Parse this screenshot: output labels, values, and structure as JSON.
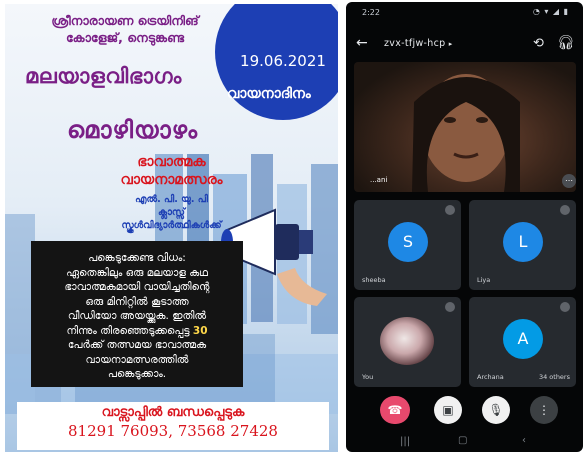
{
  "poster": {
    "header_line1": "ശ്രീനാരായണ ട്രെയിനിങ്",
    "header_line2": "കോളേജ്, നെടുങ്കണ്ട",
    "date": "19.06.2021",
    "department": "മലയാളവിഭാഗം",
    "day_name": "വായനാദിനം",
    "event_title": "മൊഴിയാഴം",
    "subtitle1": "ഭാവാത്മക",
    "subtitle2": "വായനാമത്സരം",
    "audience1": "എൽ. പി. യു. പി",
    "audience2": "ക്ലാസ്സ്",
    "audience3": "സ്കൂൾവിദ്യാർത്ഥികൾക്ക്",
    "rules": [
      "പങ്കെടുക്കേണ്ട വിധം:",
      "ഏതെങ്കിലും ഒരു മലയാള കഥ",
      "ഭാവാത്മകമായി വായിച്ചതിന്റെ",
      "ഒരു മിനിറ്റിൽ കൂടാത്ത",
      "വീഡിയോ അയയ്ക്കുക. ഇതിൽ",
      "നിന്നും തിരഞ്ഞെടുക്കപ്പെട്ട",
      "പേർക്ക് തത്സമയ ഭാവാത്മക",
      "വായനാമത്സരത്തിൽ",
      "പങ്കെടുക്കാം."
    ],
    "rules_number": "30",
    "contact_title": "വാട്സാപ്പിൽ ബന്ധപ്പെടുക",
    "contact_phones": "81291 76093, 73568 27428",
    "colors": {
      "purple": "#7a1f86",
      "red": "#d9151e",
      "blue": "#1d3fb4"
    }
  },
  "phone": {
    "status_time": "2:22",
    "status_icons": "◔ ▾ ◢ ▮",
    "meeting_code": "zvx-tfjw-hcp",
    "main_participant": "...ani",
    "tiles": [
      {
        "initial": "S",
        "name": "sheeba",
        "color": "#1e88e5"
      },
      {
        "initial": "L",
        "name": "Liya",
        "color": "#1e88e5"
      },
      {
        "initial": "",
        "name": "You",
        "color": ""
      },
      {
        "initial": "A",
        "name": "Archana",
        "extra": "34 others",
        "color": "#039be5"
      }
    ],
    "controls": {
      "end_call": "end-call",
      "video": "video",
      "mic": "mic",
      "more": "more"
    },
    "icons": {
      "back": "←",
      "switch_camera": "⟲",
      "audio": "🎧︎",
      "end": "☎",
      "video": "▣",
      "mic": "🎙︎",
      "more": "⋮"
    },
    "nav": {
      "recents": "|||",
      "home": "▢",
      "back": "‹"
    }
  }
}
